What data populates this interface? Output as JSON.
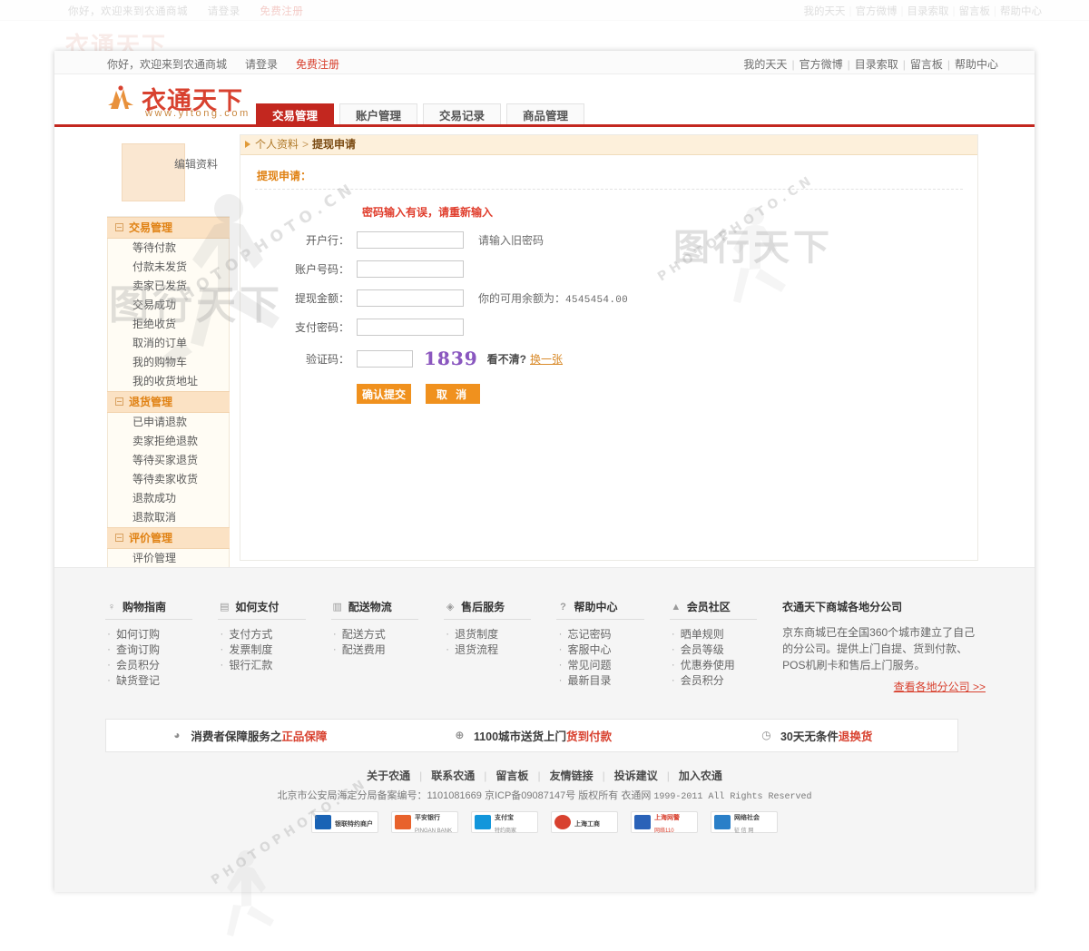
{
  "ghost": {
    "greeting": "你好，欢迎来到农通商城",
    "login": "请登录",
    "register": "免费注册",
    "nav": [
      "我的天天",
      "官方微博",
      "目录索取",
      "留言板",
      "帮助中心"
    ],
    "logo": "衣通天下"
  },
  "utilbar": {
    "greeting": "你好，欢迎来到农通商城",
    "login": "请登录",
    "register": "免费注册",
    "nav": [
      "我的天天",
      "官方微博",
      "目录索取",
      "留言板",
      "帮助中心"
    ]
  },
  "brand": {
    "name": "衣通天下",
    "url": "www.yitong.com"
  },
  "tabs": [
    {
      "label": "交易管理",
      "active": true
    },
    {
      "label": "账户管理",
      "active": false
    },
    {
      "label": "交易记录",
      "active": false
    },
    {
      "label": "商品管理",
      "active": false
    }
  ],
  "sidebar": {
    "edit_profile": "编辑资料",
    "groups": [
      {
        "title": "交易管理",
        "items": [
          "等待付款",
          "付款未发货",
          "卖家已发货",
          "交易成功",
          "拒绝收货",
          "取消的订单",
          "我的购物车",
          "我的收货地址"
        ]
      },
      {
        "title": "退货管理",
        "items": [
          "已申请退款",
          "卖家拒绝退款",
          "等待买家退货",
          "等待卖家收货",
          "退款成功",
          "退款取消"
        ]
      },
      {
        "title": "评价管理",
        "items": [
          "评价管理"
        ]
      }
    ]
  },
  "breadcrumb": {
    "parent": "个人资料",
    "separator": ">",
    "current": "提现申请"
  },
  "form": {
    "section_title": "提现申请：",
    "error": "密码输入有误，请重新输入",
    "fields": [
      {
        "label": "开户行：",
        "value": "",
        "hint": "请输入旧密码"
      },
      {
        "label": "账户号码：",
        "value": "",
        "hint": ""
      },
      {
        "label": "提现金额：",
        "value": "",
        "hint": "你的可用余额为：",
        "hint_num": "4545454.00"
      },
      {
        "label": "支付密码：",
        "value": "",
        "hint": ""
      }
    ],
    "captcha": {
      "label": "验证码：",
      "value": "",
      "code": "1839",
      "ask": "看不清?",
      "change": "换一张"
    },
    "submit": "确认提交",
    "cancel": "取 消"
  },
  "footer": {
    "columns": [
      {
        "icon": "bulb-icon",
        "glyph": "♀",
        "title": "购物指南",
        "items": [
          "如何订购",
          "查询订购",
          "会员积分",
          "缺货登记"
        ]
      },
      {
        "icon": "card-icon",
        "glyph": "▤",
        "title": "如何支付",
        "items": [
          "支付方式",
          "发票制度",
          "银行汇款"
        ]
      },
      {
        "icon": "truck-icon",
        "glyph": "▥",
        "title": "配送物流",
        "items": [
          "配送方式",
          "配送费用"
        ]
      },
      {
        "icon": "service-icon",
        "glyph": "◈",
        "title": "售后服务",
        "items": [
          "退货制度",
          "退货流程"
        ]
      },
      {
        "icon": "help-icon",
        "glyph": "?",
        "title": "帮助中心",
        "items": [
          "忘记密码",
          "客服中心",
          "常见问题",
          "最新目录"
        ]
      },
      {
        "icon": "community-icon",
        "glyph": "▲",
        "title": "会员社区",
        "items": [
          "晒单规则",
          "会员等级",
          "优惠券使用",
          "会员积分"
        ]
      }
    ],
    "branch": {
      "title": "衣通天下商城各地分公司",
      "text": "京东商城已在全国360个城市建立了自己的分公司。提供上门自提、货到付款、POS机刷卡和售后上门服务。",
      "more": "查看各地分公司 >>"
    },
    "guarantees": [
      {
        "icon": "shield-icon",
        "glyph": "◕",
        "text": "消费者保障服务之",
        "highlight": "正品保障"
      },
      {
        "icon": "globe-icon",
        "glyph": "⊕",
        "text": "1100城市送货上门 ",
        "highlight": "货到付款"
      },
      {
        "icon": "clock-icon",
        "glyph": "◷",
        "text": "30天无条件",
        "highlight": "退换货"
      }
    ],
    "links": [
      "关于农通",
      "联系农通",
      "留言板",
      "友情链接",
      "投诉建议",
      "加入农通"
    ],
    "copyright_cn": "北京市公安局海定分局备案编号：1101081669 京ICP备09087147号  版权所有 衣通网",
    "copyright_en": "1999-2011 All Rights Reserved",
    "badges": [
      {
        "name": "unionpay-badge",
        "color": "#1a63b5",
        "t1": "银联特约商户",
        "t2": ""
      },
      {
        "name": "pingan-badge",
        "color": "#e8622c",
        "t1": "平安银行",
        "t2": "PINGAN BANK"
      },
      {
        "name": "alipay-badge",
        "color": "#1296db",
        "t1": "支付宝",
        "t2": "特约商家"
      },
      {
        "name": "shanghai-ic-badge",
        "color": "#d8412f",
        "t1": "上海工商",
        "t2": ""
      },
      {
        "name": "police110-badge",
        "color": "#2a62b8",
        "t1": "上海网警",
        "t2": "网络110"
      },
      {
        "name": "credit-badge",
        "color": "#2a7fc8",
        "t1": "网络社会",
        "t2": "征 信 网"
      }
    ]
  },
  "colors": {
    "brand_red": "#c3271f",
    "accent_orange": "#f0911e",
    "error_red": "#e03e2d",
    "group_bg": "#fbe2c4"
  }
}
